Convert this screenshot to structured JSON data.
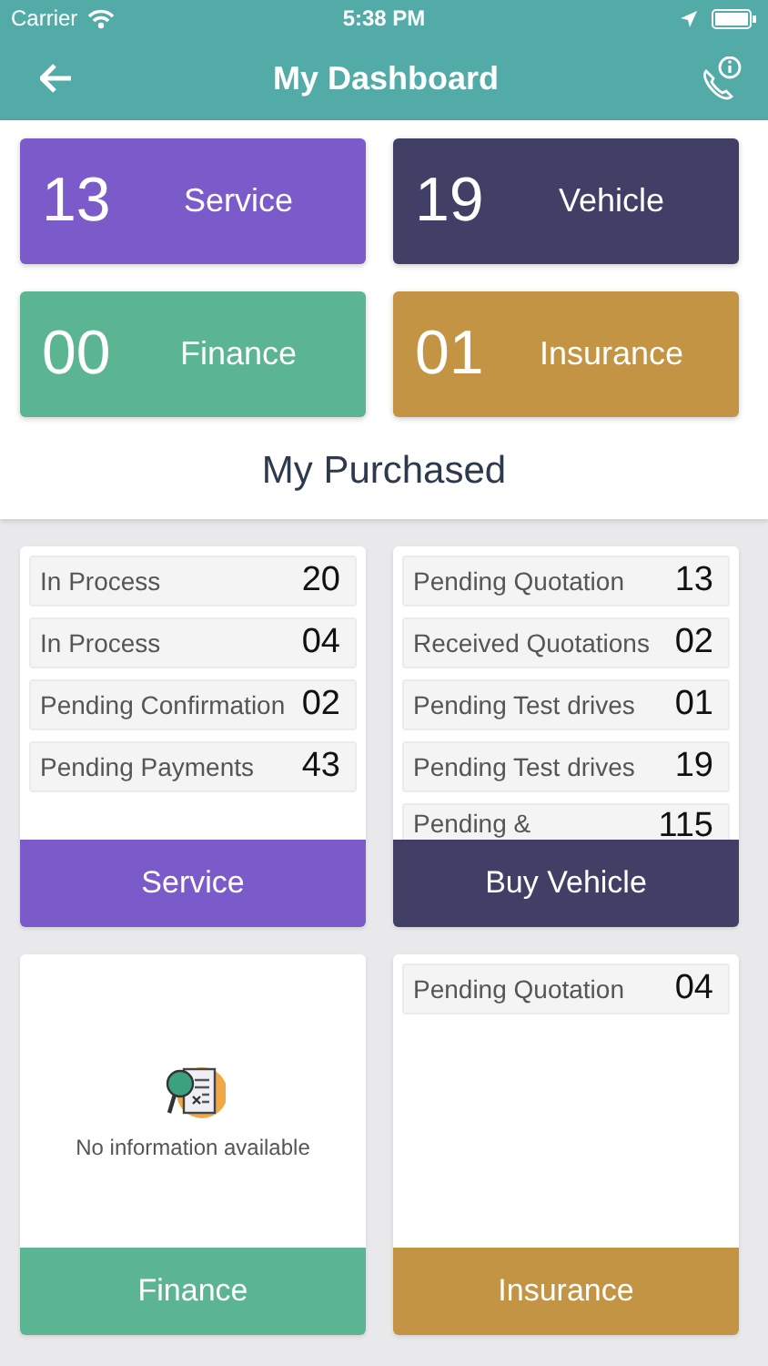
{
  "status_bar": {
    "carrier": "Carrier",
    "time": "5:38 PM"
  },
  "header": {
    "title": "My Dashboard"
  },
  "tiles": [
    {
      "count": "13",
      "label": "Service",
      "color": "#7a5bc9"
    },
    {
      "count": "19",
      "label": "Vehicle",
      "color": "#413f66"
    },
    {
      "count": "00",
      "label": "Finance",
      "color": "#5bb592"
    },
    {
      "count": "01",
      "label": "Insurance",
      "color": "#c29443"
    }
  ],
  "section_title": "My Purchased",
  "card_rows": [
    {
      "cards": [
        {
          "kind": "list",
          "rows": [
            {
              "label": "In Process",
              "value": "20"
            },
            {
              "label": "In Process",
              "value": "04"
            },
            {
              "label": "Pending Confirmation",
              "value": "02"
            },
            {
              "label": "Pending Payments",
              "value": "43"
            }
          ],
          "button": "Service",
          "color": "#7a5bc9"
        },
        {
          "kind": "list",
          "rows": [
            {
              "label": "Pending Quotation",
              "value": "13"
            },
            {
              "label": "Received Quotations",
              "value": "02"
            },
            {
              "label": "Pending Test drives",
              "value": "01"
            },
            {
              "label": "Pending Test drives",
              "value": "19"
            },
            {
              "label": "Pending &",
              "value": "115"
            }
          ],
          "button": "Buy Vehicle",
          "color": "#413f66"
        }
      ]
    },
    {
      "cards": [
        {
          "kind": "empty",
          "message": "No information available",
          "button": "Finance",
          "color": "#5bb592"
        },
        {
          "kind": "list",
          "rows": [
            {
              "label": "Pending Quotation",
              "value": "04"
            }
          ],
          "button": "Insurance",
          "color": "#c29443"
        }
      ]
    }
  ]
}
